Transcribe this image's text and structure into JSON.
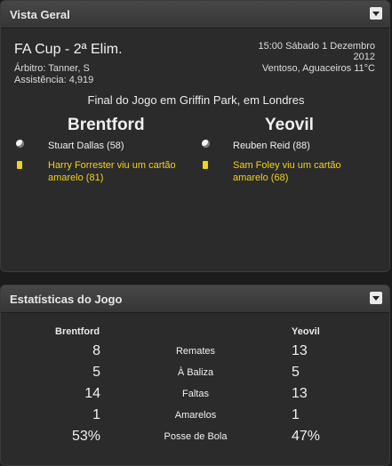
{
  "overview": {
    "title": "Vista Geral",
    "competition": "FA Cup - 2ª Elim.",
    "referee": "Árbitro: Tanner, S",
    "attendance": "Assistência: 4,919",
    "datetime_line1": "15:00 Sábado 1 Dezembro",
    "datetime_line2": "2012",
    "weather": "Ventoso, Aguaceiros 11°C",
    "final_text": "Final do Jogo em Griffin Park, em Londres",
    "home_team": "Brentford",
    "away_team": "Yeovil",
    "home_events": [
      {
        "type": "goal",
        "icon": "ball-icon",
        "text": "Stuart Dallas (58)"
      },
      {
        "type": "yellow-card",
        "icon": "yellow-card-icon",
        "text": "Harry Forrester viu um cartão amarelo (81)"
      }
    ],
    "away_events": [
      {
        "type": "goal",
        "icon": "ball-icon",
        "text": "Reuben Reid (88)"
      },
      {
        "type": "yellow-card",
        "icon": "yellow-card-icon",
        "text": "Sam Foley viu um cartão amarelo (68)"
      }
    ]
  },
  "stats": {
    "title": "Estatísticas do Jogo",
    "home_team": "Brentford",
    "away_team": "Yeovil",
    "rows": [
      {
        "label": "Remates",
        "home": "8",
        "away": "13"
      },
      {
        "label": "À Baliza",
        "home": "5",
        "away": "5"
      },
      {
        "label": "Faltas",
        "home": "14",
        "away": "13"
      },
      {
        "label": "Amarelos",
        "home": "1",
        "away": "1"
      },
      {
        "label": "Posse de Bola",
        "home": "53%",
        "away": "47%"
      }
    ]
  },
  "colors": {
    "background": "#1c1c1c",
    "panel": "#2b2b2b",
    "event_yellow": "#f2d21b"
  }
}
